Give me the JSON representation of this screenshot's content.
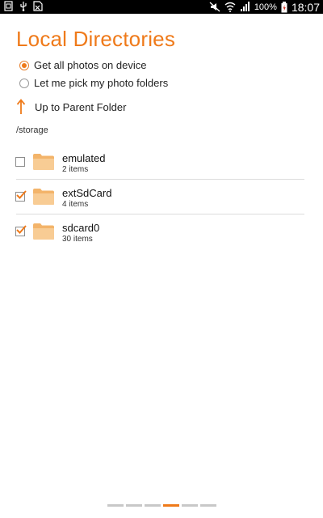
{
  "status_bar": {
    "left_icons": [
      "notification-icon",
      "usb-icon",
      "sdcard-icon"
    ],
    "right_icons": [
      "mute-icon",
      "wifi-icon",
      "signal-icon",
      "battery-icon"
    ],
    "battery_percent": "100%",
    "time": "18:07"
  },
  "title": "Local Directories",
  "options": [
    {
      "label": "Get all photos on device",
      "selected": true
    },
    {
      "label": "Let me pick my photo folders",
      "selected": false
    }
  ],
  "parent_folder": {
    "label": "Up to Parent Folder",
    "icon": "arrow-up-icon"
  },
  "current_path": "/storage",
  "folders": [
    {
      "name": "emulated",
      "count": "2 items",
      "checked": false
    },
    {
      "name": "extSdCard",
      "count": "4 items",
      "checked": true
    },
    {
      "name": "sdcard0",
      "count": "30 items",
      "checked": true
    }
  ],
  "pager": {
    "total": 6,
    "active": 4
  },
  "colors": {
    "accent": "#ef7a1a",
    "folder": "#f6c27e",
    "divider": "#dcdcdc"
  }
}
